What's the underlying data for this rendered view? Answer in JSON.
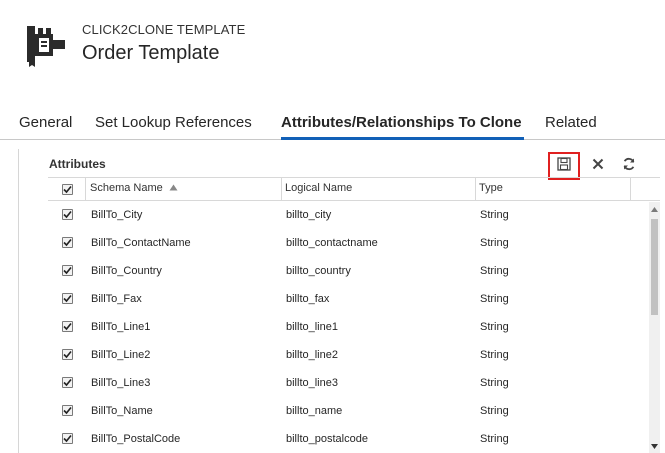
{
  "header": {
    "entity_type": "CLICK2CLONE TEMPLATE",
    "record_title": "Order Template"
  },
  "tabs": [
    {
      "label": "General"
    },
    {
      "label": "Set Lookup References"
    },
    {
      "label": "Attributes/Relationships To Clone",
      "active": true
    },
    {
      "label": "Related"
    }
  ],
  "section": {
    "title": "Attributes",
    "toolbar": {
      "save_icon": "save-icon",
      "close_icon": "close-icon",
      "refresh_icon": "refresh-icon"
    }
  },
  "grid": {
    "columns": [
      {
        "label": "Schema Name",
        "sort": "ascending"
      },
      {
        "label": "Logical Name"
      },
      {
        "label": "Type"
      }
    ],
    "select_all_checked": true,
    "rows": [
      {
        "checked": true,
        "schema_name": "BillTo_City",
        "logical_name": "billto_city",
        "type": "String"
      },
      {
        "checked": true,
        "schema_name": "BillTo_ContactName",
        "logical_name": "billto_contactname",
        "type": "String"
      },
      {
        "checked": true,
        "schema_name": "BillTo_Country",
        "logical_name": "billto_country",
        "type": "String"
      },
      {
        "checked": true,
        "schema_name": "BillTo_Fax",
        "logical_name": "billto_fax",
        "type": "String"
      },
      {
        "checked": true,
        "schema_name": "BillTo_Line1",
        "logical_name": "billto_line1",
        "type": "String"
      },
      {
        "checked": true,
        "schema_name": "BillTo_Line2",
        "logical_name": "billto_line2",
        "type": "String"
      },
      {
        "checked": true,
        "schema_name": "BillTo_Line3",
        "logical_name": "billto_line3",
        "type": "String"
      },
      {
        "checked": true,
        "schema_name": "BillTo_Name",
        "logical_name": "billto_name",
        "type": "String"
      },
      {
        "checked": true,
        "schema_name": "BillTo_PostalCode",
        "logical_name": "billto_postalcode",
        "type": "String"
      }
    ]
  },
  "colors": {
    "accent": "#1160b7",
    "highlight": "#e02020"
  }
}
